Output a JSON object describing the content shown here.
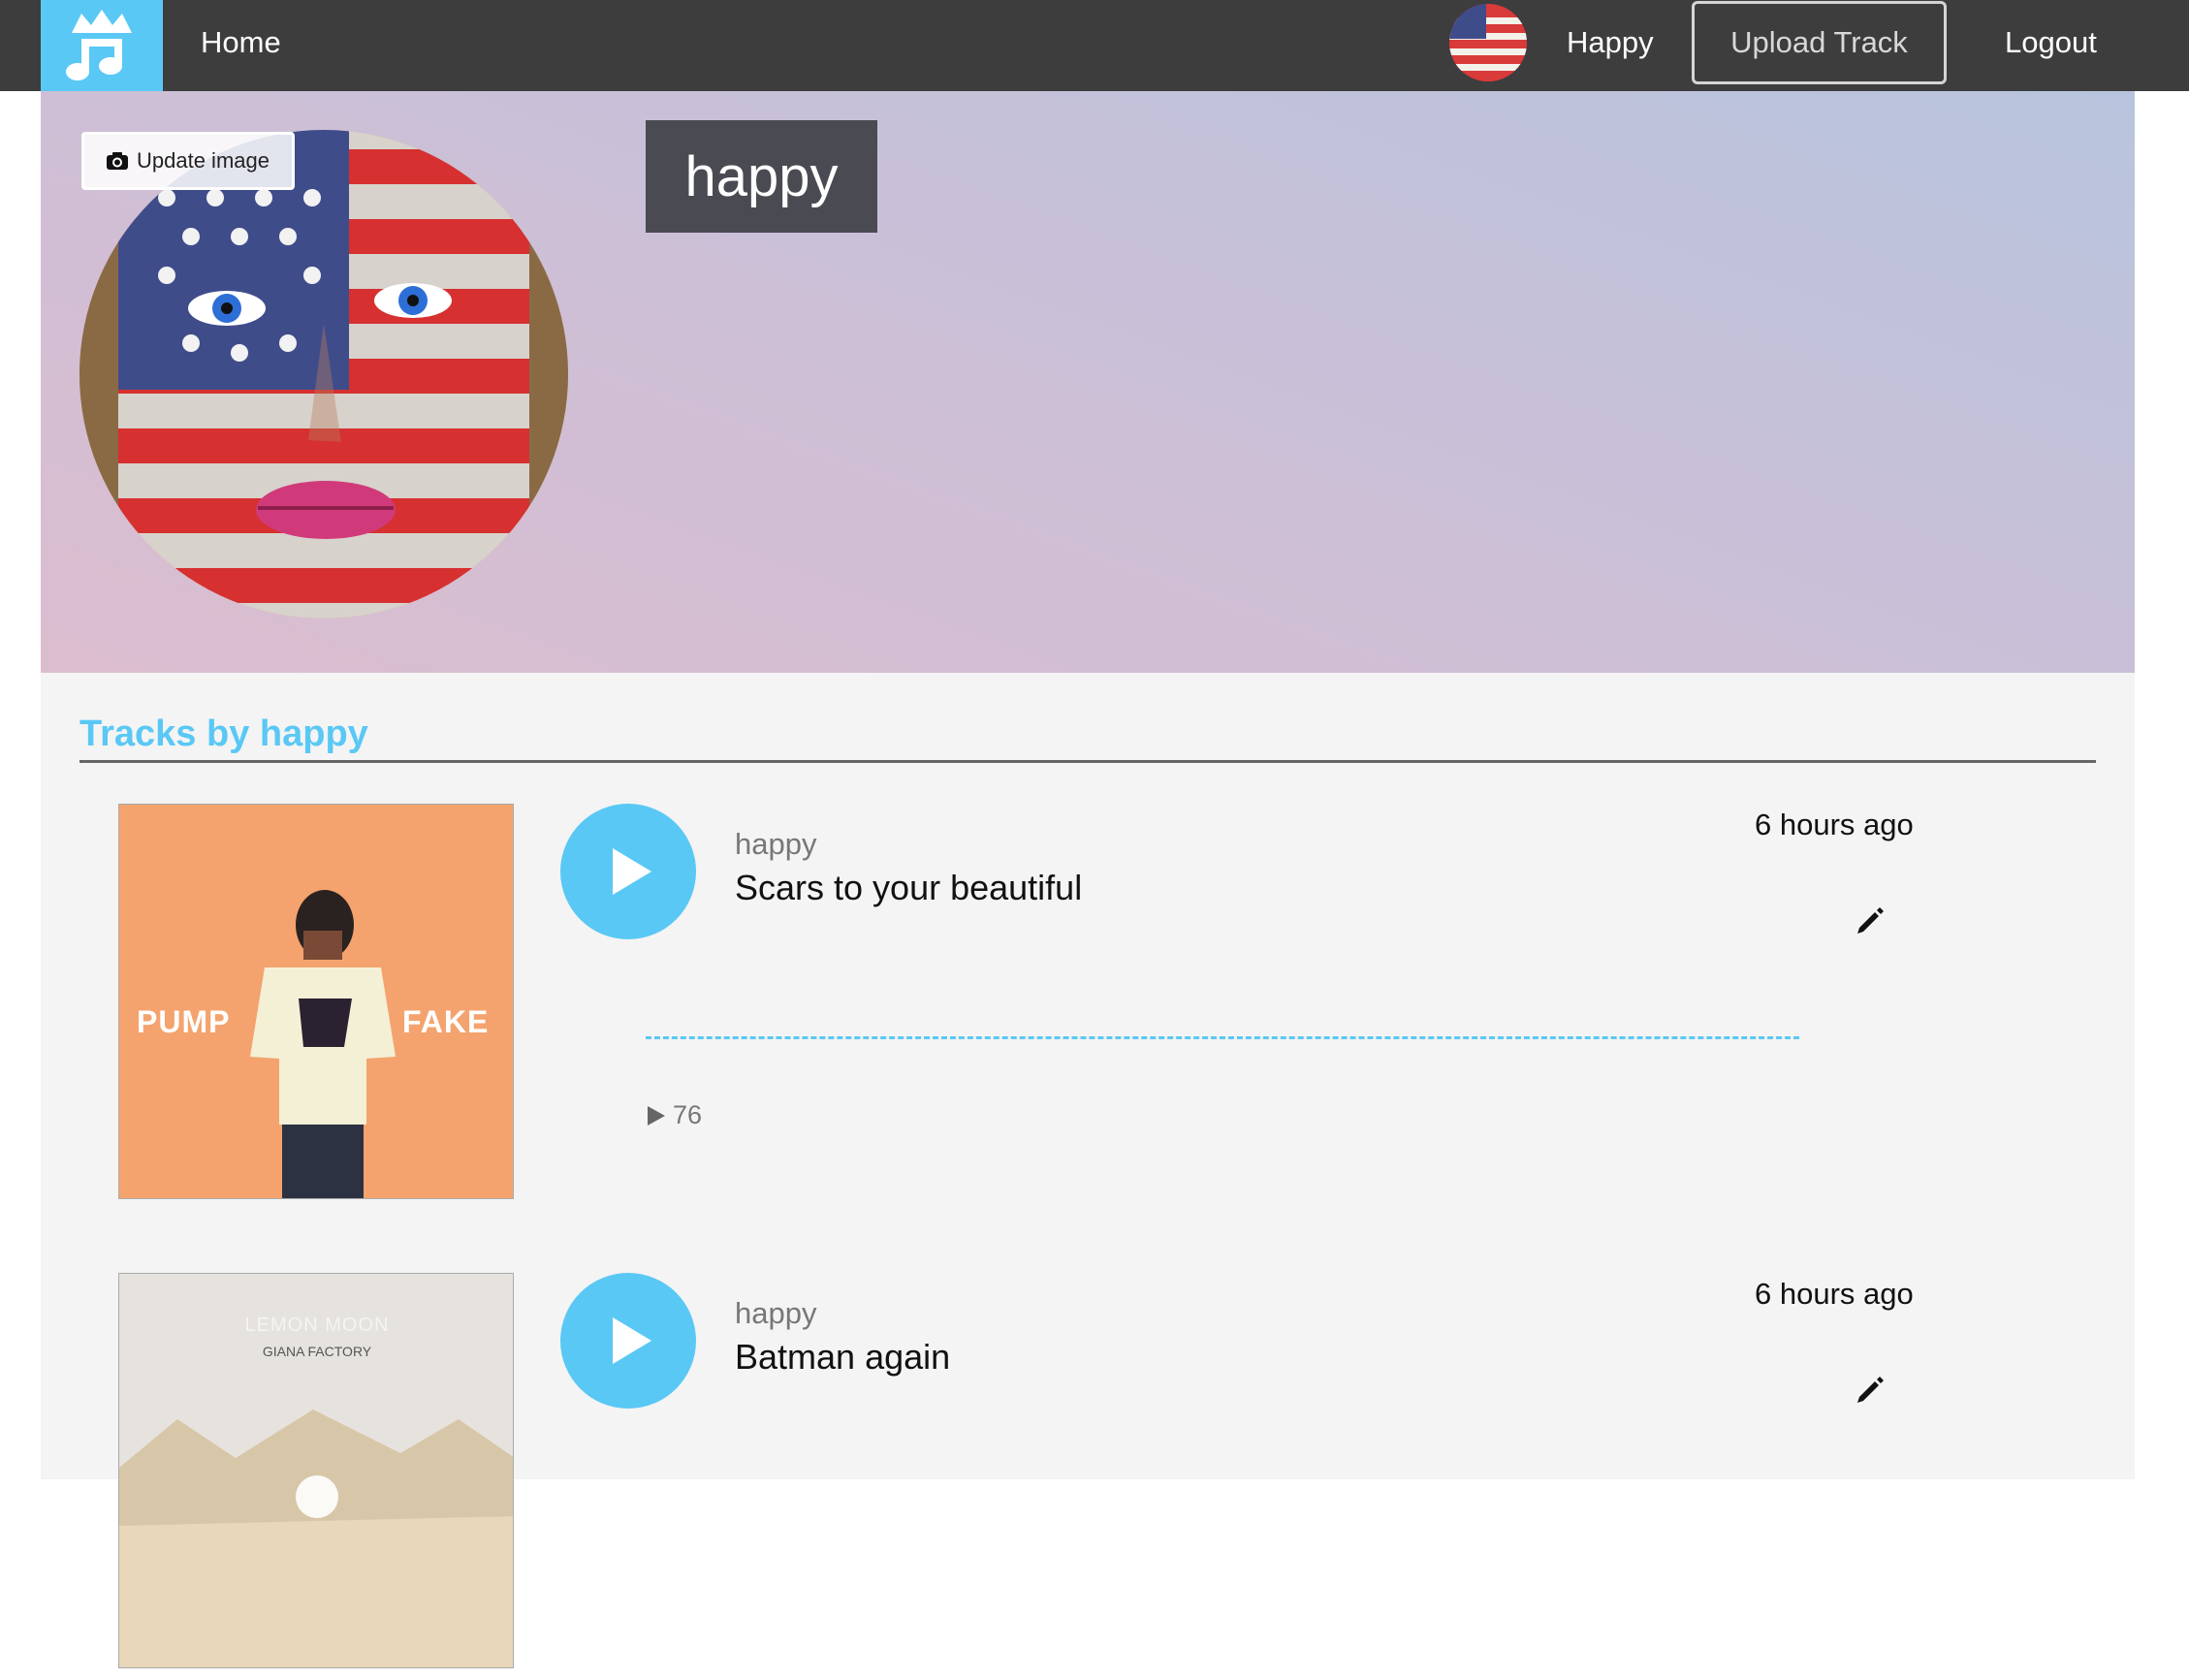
{
  "nav": {
    "home_label": "Home",
    "user_name": "Happy",
    "upload_label": "Upload Track",
    "logout_label": "Logout",
    "logo_icon": "crown-music-note-icon"
  },
  "profile": {
    "update_image_label": "Update image",
    "display_name": "happy",
    "camera_icon": "camera-icon"
  },
  "tracks_section": {
    "title": "Tracks by happy"
  },
  "tracks": [
    {
      "artist": "happy",
      "title": "Scars to your beautiful",
      "time_ago": "6 hours ago",
      "play_count": "76",
      "cover_text_left": "PUMP",
      "cover_text_right": "FAKE"
    },
    {
      "artist": "happy",
      "title": "Batman again",
      "time_ago": "6 hours ago",
      "cover_text_top": "LEMON MOON",
      "cover_text_sub": "GIANA FACTORY"
    }
  ],
  "colors": {
    "accent": "#5ac8f5",
    "navbar": "#3d3d3d",
    "name_box": "#4a4a52"
  }
}
